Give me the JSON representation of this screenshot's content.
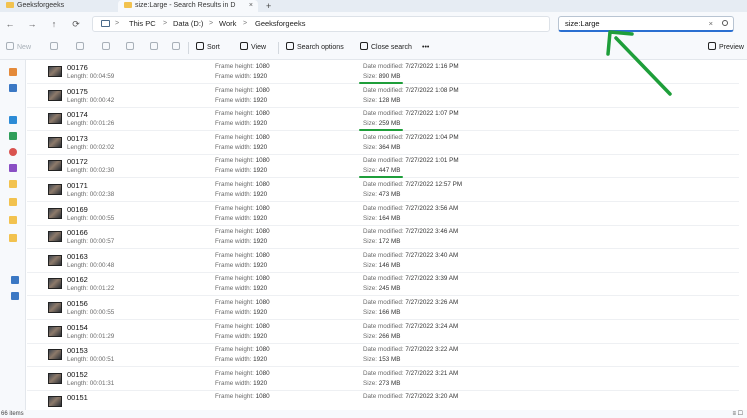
{
  "tabs": [
    {
      "label": "Geeksforgeeks"
    },
    {
      "label": "size:Large - Search Results in D"
    }
  ],
  "tab_add": "+",
  "tab_close": "×",
  "nav": {
    "back": "←",
    "forward": "→",
    "up": "↑",
    "refresh": "⟳"
  },
  "breadcrumb": [
    {
      "label": "This PC"
    },
    {
      "label": "Data (D:)"
    },
    {
      "label": "Work"
    },
    {
      "label": "Geeksforgeeks"
    }
  ],
  "breadcrumb_sep": ">",
  "search": {
    "value": "size:Large",
    "clear": "×"
  },
  "toolbar": {
    "new_label": "New",
    "sort_label": "Sort",
    "view_label": "View",
    "search_options_label": "Search options",
    "close_search_label": "Close search",
    "more_label": "•••",
    "preview_label": "Preview"
  },
  "labels": {
    "length": "Length:",
    "frame_height": "Frame height:",
    "frame_width": "Frame width:",
    "date_modified": "Date modified:",
    "size": "Size:"
  },
  "files": [
    {
      "name": "00176",
      "length": "00:04:59",
      "frame_height": "1080",
      "frame_width": "1920",
      "date_modified": "7/27/2022 1:16 PM",
      "size": "890 MB",
      "highlight": true
    },
    {
      "name": "00175",
      "length": "00:00:42",
      "frame_height": "1080",
      "frame_width": "1920",
      "date_modified": "7/27/2022 1:08 PM",
      "size": "128 MB",
      "highlight": false
    },
    {
      "name": "00174",
      "length": "00:01:26",
      "frame_height": "1080",
      "frame_width": "1920",
      "date_modified": "7/27/2022 1:07 PM",
      "size": "259 MB",
      "highlight": true
    },
    {
      "name": "00173",
      "length": "00:02:02",
      "frame_height": "1080",
      "frame_width": "1920",
      "date_modified": "7/27/2022 1:04 PM",
      "size": "364 MB",
      "highlight": false
    },
    {
      "name": "00172",
      "length": "00:02:30",
      "frame_height": "1080",
      "frame_width": "1920",
      "date_modified": "7/27/2022 1:01 PM",
      "size": "447 MB",
      "highlight": true
    },
    {
      "name": "00171",
      "length": "00:02:38",
      "frame_height": "1080",
      "frame_width": "1920",
      "date_modified": "7/27/2022 12:57 PM",
      "size": "473 MB",
      "highlight": false
    },
    {
      "name": "00169",
      "length": "00:00:55",
      "frame_height": "1080",
      "frame_width": "1920",
      "date_modified": "7/27/2022 3:56 AM",
      "size": "164 MB",
      "highlight": false
    },
    {
      "name": "00166",
      "length": "00:00:57",
      "frame_height": "1080",
      "frame_width": "1920",
      "date_modified": "7/27/2022 3:46 AM",
      "size": "172 MB",
      "highlight": false
    },
    {
      "name": "00163",
      "length": "00:00:48",
      "frame_height": "1080",
      "frame_width": "1920",
      "date_modified": "7/27/2022 3:40 AM",
      "size": "146 MB",
      "highlight": false
    },
    {
      "name": "00162",
      "length": "00:01:22",
      "frame_height": "1080",
      "frame_width": "1920",
      "date_modified": "7/27/2022 3:39 AM",
      "size": "245 MB",
      "highlight": false
    },
    {
      "name": "00156",
      "length": "00:00:55",
      "frame_height": "1080",
      "frame_width": "1920",
      "date_modified": "7/27/2022 3:26 AM",
      "size": "166 MB",
      "highlight": false
    },
    {
      "name": "00154",
      "length": "00:01:29",
      "frame_height": "1080",
      "frame_width": "1920",
      "date_modified": "7/27/2022 3:24 AM",
      "size": "266 MB",
      "highlight": false
    },
    {
      "name": "00153",
      "length": "00:00:51",
      "frame_height": "1080",
      "frame_width": "1920",
      "date_modified": "7/27/2022 3:22 AM",
      "size": "153 MB",
      "highlight": false
    },
    {
      "name": "00152",
      "length": "00:01:31",
      "frame_height": "1080",
      "frame_width": "1920",
      "date_modified": "7/27/2022 3:21 AM",
      "size": "273 MB",
      "highlight": false
    },
    {
      "name": "00151",
      "length": "",
      "frame_height": "1080",
      "frame_width": "",
      "date_modified": "7/27/2022 3:20 AM",
      "size": "",
      "highlight": false
    }
  ],
  "status": {
    "item_count": "66 items"
  },
  "colors": {
    "annotation": "#1e9e3a",
    "accent": "#2a6fd1"
  }
}
